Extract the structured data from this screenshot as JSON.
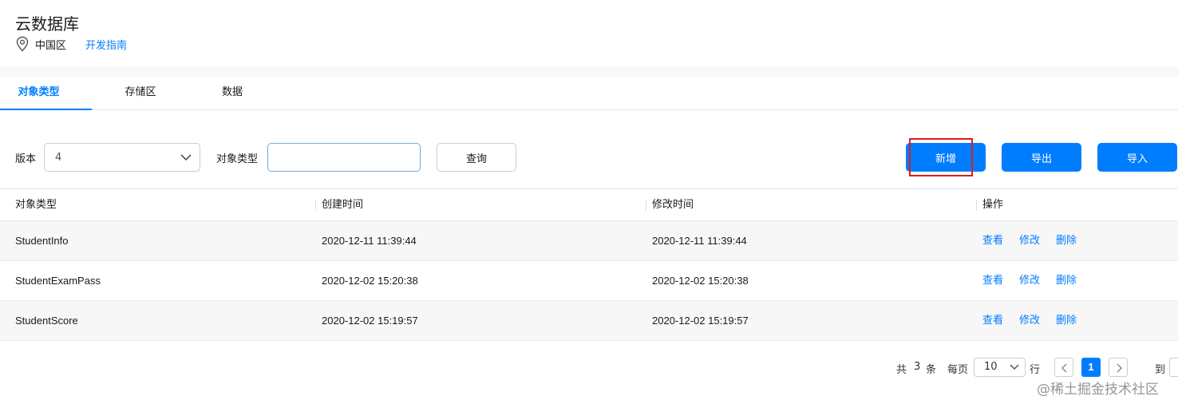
{
  "header": {
    "title": "云数据库",
    "region": "中国区",
    "dev_guide": "开发指南"
  },
  "tabs": [
    {
      "label": "对象类型",
      "active": true
    },
    {
      "label": "存储区",
      "active": false
    },
    {
      "label": "数据",
      "active": false
    }
  ],
  "filter": {
    "version_label": "版本",
    "version_value": "4",
    "type_label": "对象类型",
    "type_value": "",
    "query_button": "查询"
  },
  "actions": {
    "add": "新增",
    "export": "导出",
    "import": "导入"
  },
  "table": {
    "columns": [
      "对象类型",
      "创建时间",
      "修改时间",
      "操作"
    ],
    "rows": [
      {
        "name": "StudentInfo",
        "created": "2020-12-11 11:39:44",
        "modified": "2020-12-11 11:39:44"
      },
      {
        "name": "StudentExamPass",
        "created": "2020-12-02 15:20:38",
        "modified": "2020-12-02 15:20:38"
      },
      {
        "name": "StudentScore",
        "created": "2020-12-02 15:19:57",
        "modified": "2020-12-02 15:19:57"
      }
    ],
    "row_actions": [
      "查看",
      "修改",
      "删除"
    ]
  },
  "pagination": {
    "total_prefix": "共",
    "total": "3",
    "total_suffix": "条",
    "per_page_label": "每页",
    "per_page": "10",
    "per_page_suffix": "行",
    "current_page": "1",
    "goto_label": "到"
  },
  "watermark": "@稀土掘金技术社区",
  "colors": {
    "accent": "#007dff",
    "highlight": "#e01a1a"
  }
}
